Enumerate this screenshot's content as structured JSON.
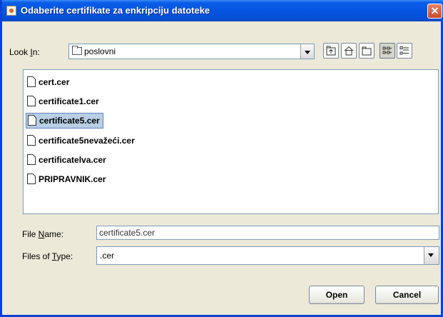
{
  "window": {
    "title": "Odaberite certifikate za enkripciju datoteke",
    "close_symbol": "✕"
  },
  "look_in": {
    "label_prefix": "Look ",
    "label_mnemonic": "I",
    "label_suffix": "n:",
    "value": "poslovni"
  },
  "toolbar": {
    "buttons": [
      {
        "name": "up-one-level-icon"
      },
      {
        "name": "home-icon"
      },
      {
        "name": "new-folder-icon"
      },
      {
        "name": "list-view-icon",
        "pressed": true
      },
      {
        "name": "details-view-icon"
      }
    ]
  },
  "files": [
    {
      "name": "cert.cer",
      "selected": false
    },
    {
      "name": "certificate1.cer",
      "selected": false
    },
    {
      "name": "certificate5.cer",
      "selected": true
    },
    {
      "name": "certificate5nevažeći.cer",
      "selected": false
    },
    {
      "name": "certificatelva.cer",
      "selected": false
    },
    {
      "name": "PRIPRAVNIK.cer",
      "selected": false
    }
  ],
  "file_name": {
    "label_prefix": "File ",
    "label_mnemonic": "N",
    "label_suffix": "ame:",
    "value": "certificate5.cer"
  },
  "files_of_type": {
    "label_prefix": "Files of ",
    "label_mnemonic": "T",
    "label_suffix": "ype:",
    "value": ".cer"
  },
  "buttons": {
    "open": "Open",
    "cancel": "Cancel"
  },
  "colors": {
    "title_bar": "#0654e0",
    "selection": "#b8cfe5",
    "dialog_bg": "#ece9d8"
  }
}
